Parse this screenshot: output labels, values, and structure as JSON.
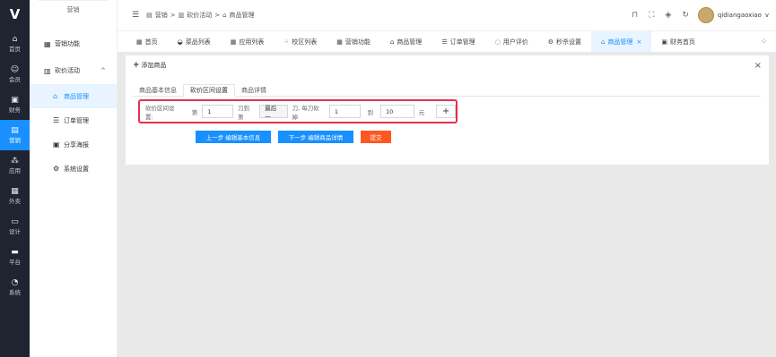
{
  "rail": {
    "logo": "V",
    "items": [
      {
        "icon": "⌂",
        "label": "首页"
      },
      {
        "icon": "☺",
        "label": "会员"
      },
      {
        "icon": "▣",
        "label": "财务"
      },
      {
        "icon": "▤",
        "label": "营销"
      },
      {
        "icon": "⁂",
        "label": "应用"
      },
      {
        "icon": "▦",
        "label": "外卖"
      },
      {
        "icon": "▭",
        "label": "设计"
      },
      {
        "icon": "▬",
        "label": "平台"
      },
      {
        "icon": "◔",
        "label": "系统"
      }
    ]
  },
  "submenu": {
    "title": "营销",
    "items": [
      {
        "icon": "▦",
        "label": "营销功能"
      },
      {
        "icon": "▥",
        "label": "砍价活动",
        "arrow": "^"
      },
      {
        "icon": "⌂",
        "label": "商品管理"
      },
      {
        "icon": "☰",
        "label": "订单管理"
      },
      {
        "icon": "▣",
        "label": "分享海报"
      },
      {
        "icon": "⚙",
        "label": "系统设置"
      }
    ]
  },
  "topbar": {
    "menu_icon": "☰",
    "crumb1": "营销",
    "crumb2": "砍价活动",
    "crumb3": "商品管理",
    "sep": ">",
    "username": "qidiangaoxiao",
    "dropdown": "v"
  },
  "tabs": [
    {
      "icon": "▦",
      "label": "首页"
    },
    {
      "icon": "◒",
      "label": "菜品列表"
    },
    {
      "icon": "▦",
      "label": "应用列表"
    },
    {
      "icon": "⁘",
      "label": "校区列表"
    },
    {
      "icon": "▦",
      "label": "营销功能"
    },
    {
      "icon": "⌂",
      "label": "商品管理"
    },
    {
      "icon": "☰",
      "label": "订单管理"
    },
    {
      "icon": "◌",
      "label": "用户评价"
    },
    {
      "icon": "⚙",
      "label": "秒杀设置"
    },
    {
      "icon": "⌂",
      "label": "商品管理",
      "close": "×"
    },
    {
      "icon": "▣",
      "label": "财务首页"
    }
  ],
  "card": {
    "title": "添加商品",
    "plus": "+",
    "close": "×",
    "inner_tabs": [
      "商品基本信息",
      "砍价区间设置",
      "商品详情"
    ],
    "form": {
      "label": "砍价区间设置:",
      "t1": "第",
      "v1": "1",
      "t2": "刀到第",
      "select": "最后一",
      "t3": "刀, 每刀砍掉",
      "v2": "1",
      "t4": "到",
      "v3": "10",
      "t5": "元",
      "add": "+"
    },
    "buttons": {
      "prev": "上一步 编辑基本信息",
      "next": "下一步 编辑商品详情",
      "submit": "提交"
    }
  },
  "colors": {
    "accent": "#1890ff",
    "rail": "#1f2430",
    "highlight_border": "#e4324c",
    "submit": "#ff5722"
  }
}
